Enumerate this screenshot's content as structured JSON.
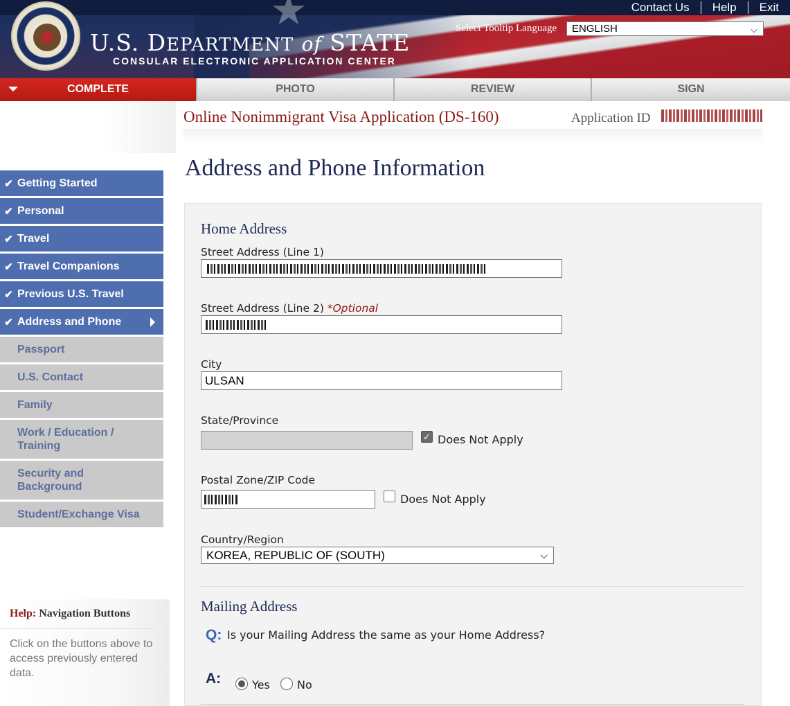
{
  "header": {
    "dept_title_pre": "U.S. D",
    "dept_title_main": "EPARTMENT",
    "dept_title_of": "of",
    "dept_title_post": "STATE",
    "dept_subtitle": "CONSULAR ELECTRONIC APPLICATION CENTER",
    "links": [
      "Contact Us",
      "Help",
      "Exit"
    ],
    "tooltip_label": "Select Tooltip Language",
    "tooltip_value": "ENGLISH",
    "seal_text": "DEPARTMENT OF STATE · UNITED STATES OF AMERICA"
  },
  "tabs": [
    {
      "label": "COMPLETE",
      "active": true
    },
    {
      "label": "PHOTO",
      "active": false
    },
    {
      "label": "REVIEW",
      "active": false
    },
    {
      "label": "SIGN",
      "active": false
    }
  ],
  "app": {
    "title": "Online Nonimmigrant Visa Application (DS-160)",
    "id_label": "Application ID",
    "id_value": ""
  },
  "sidebar": {
    "items": [
      {
        "label": "Getting Started",
        "status": "done"
      },
      {
        "label": "Personal",
        "status": "done"
      },
      {
        "label": "Travel",
        "status": "done"
      },
      {
        "label": "Travel Companions",
        "status": "done"
      },
      {
        "label": "Previous U.S. Travel",
        "status": "done"
      },
      {
        "label": "Address and Phone",
        "status": "current"
      },
      {
        "label": "Passport",
        "status": "pending"
      },
      {
        "label": "U.S. Contact",
        "status": "pending"
      },
      {
        "label": "Family",
        "status": "pending"
      },
      {
        "label": "Work / Education / Training",
        "status": "pending"
      },
      {
        "label": "Security and Background",
        "status": "pending"
      },
      {
        "label": "Student/Exchange Visa",
        "status": "pending"
      }
    ],
    "help": {
      "prefix": "Help:",
      "title": "Navigation Buttons",
      "text": "Click on the buttons above to access previously entered data."
    }
  },
  "page": {
    "title": "Address and Phone Information",
    "home_address": {
      "heading": "Home Address",
      "street1_label": "Street Address (Line 1)",
      "street1_value": "",
      "street2_label": "Street Address (Line 2)",
      "street2_optional": "*Optional",
      "street2_value": "",
      "city_label": "City",
      "city_value": "ULSAN",
      "state_label": "State/Province",
      "state_value": "",
      "state_dna_label": "Does Not Apply",
      "state_dna_checked": true,
      "zip_label": "Postal Zone/ZIP Code",
      "zip_value": "",
      "zip_dna_label": "Does Not Apply",
      "zip_dna_checked": false,
      "country_label": "Country/Region",
      "country_value": "KOREA, REPUBLIC OF (SOUTH)"
    },
    "mailing_address": {
      "heading": "Mailing Address",
      "q_letter": "Q:",
      "question": "Is your Mailing Address the same as your Home Address?",
      "a_letter": "A:",
      "options": [
        "Yes",
        "No"
      ],
      "selected": "Yes"
    }
  },
  "colors": {
    "brand_navy": "#1c2a55",
    "active_tab_red": "#c1221b",
    "nav_done_blue": "#4f6eb0",
    "nav_pending_gray": "#c9c9c9",
    "heading_maroon": "#8a1a14"
  }
}
